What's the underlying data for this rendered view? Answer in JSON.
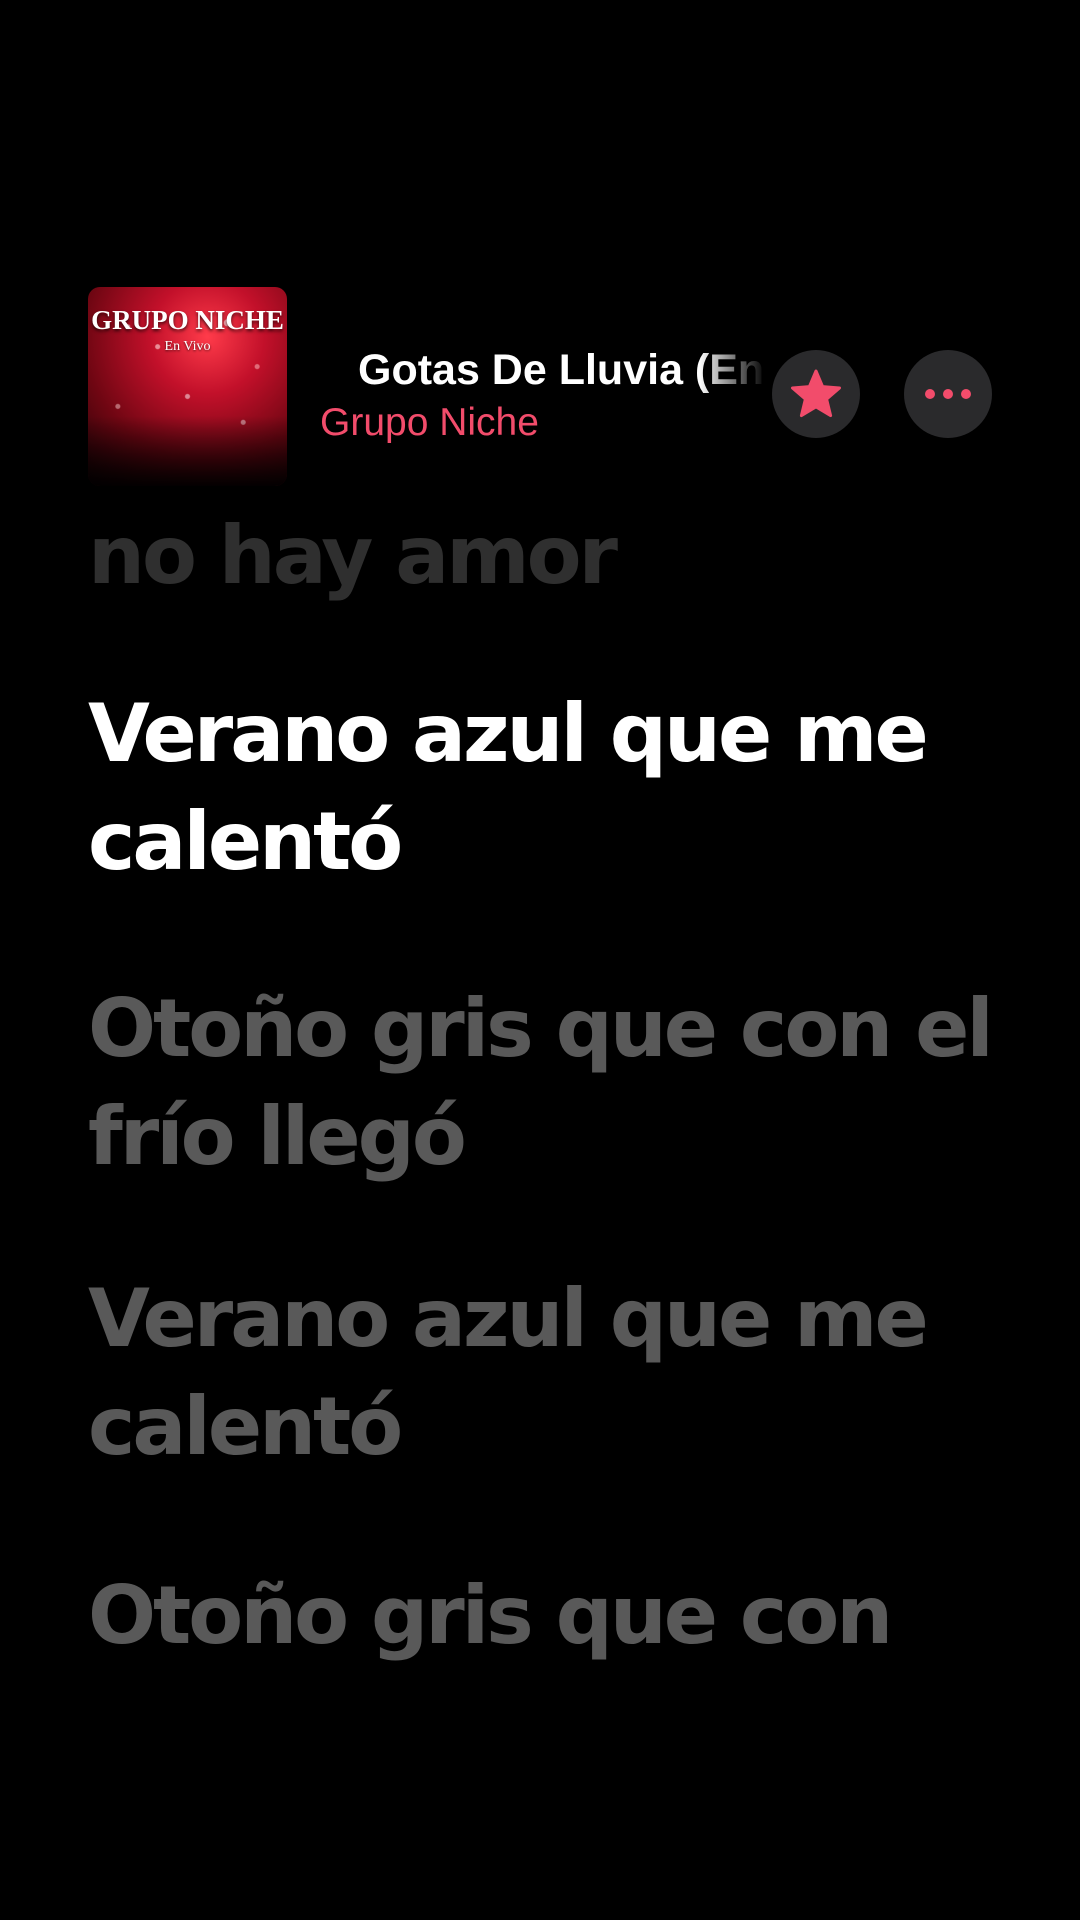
{
  "now_playing": {
    "artwork": {
      "title": "GRUPO NICHE",
      "subtitle": "En Vivo"
    },
    "song_title": "Gotas De Lluvia (En Vivo)",
    "artist": "Grupo Niche",
    "favorite_icon": "star-icon",
    "more_icon": "ellipsis-icon"
  },
  "colors": {
    "background": "#000000",
    "accent": "#f24c6b",
    "active_lyric": "#ffffff",
    "inactive_lyric": "#595959",
    "button_background": "#2a2a2c"
  },
  "lyrics": {
    "previous_line": "no hay amor",
    "current_line": "Verano azul que me calentó",
    "upcoming_lines": [
      "Otoño gris que con el frío llegó",
      "Verano azul que me calentó",
      "Otoño gris que con"
    ]
  }
}
